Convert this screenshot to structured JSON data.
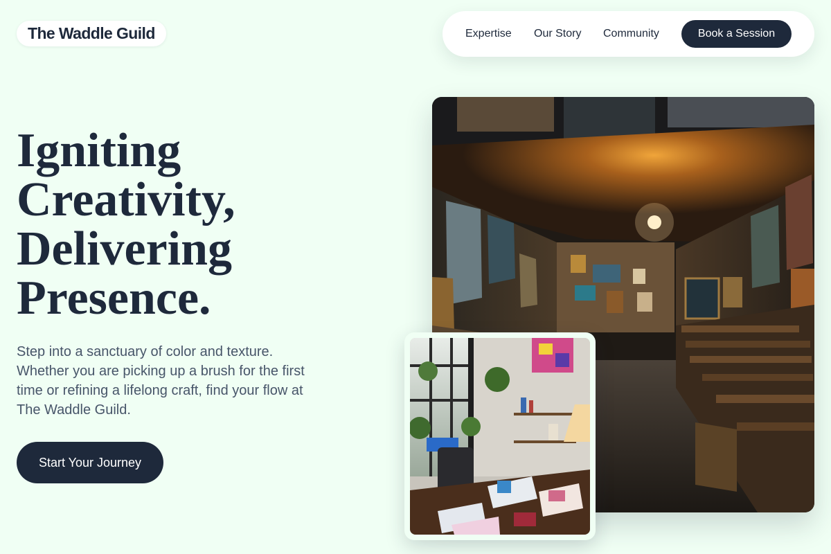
{
  "header": {
    "brand": "The Waddle Guild",
    "nav": [
      "Expertise",
      "Our Story",
      "Community"
    ],
    "cta": "Book a Session"
  },
  "hero": {
    "title_lines": [
      "Igniting",
      "Creativity,",
      "Delivering",
      "Presence."
    ],
    "description": "Step into a sanctuary of color and texture. Whether you are picking up a brush for the first time or refining a lifelong craft, find your flow at The Waddle Guild.",
    "cta": "Start Your Journey"
  },
  "images": {
    "main": "art-gallery-corridor-photo",
    "secondary": "artist-studio-desk-photo"
  },
  "colors": {
    "background": "#f0fff4",
    "primary": "#1e293b",
    "text_muted": "#475569",
    "surface": "#ffffff"
  }
}
